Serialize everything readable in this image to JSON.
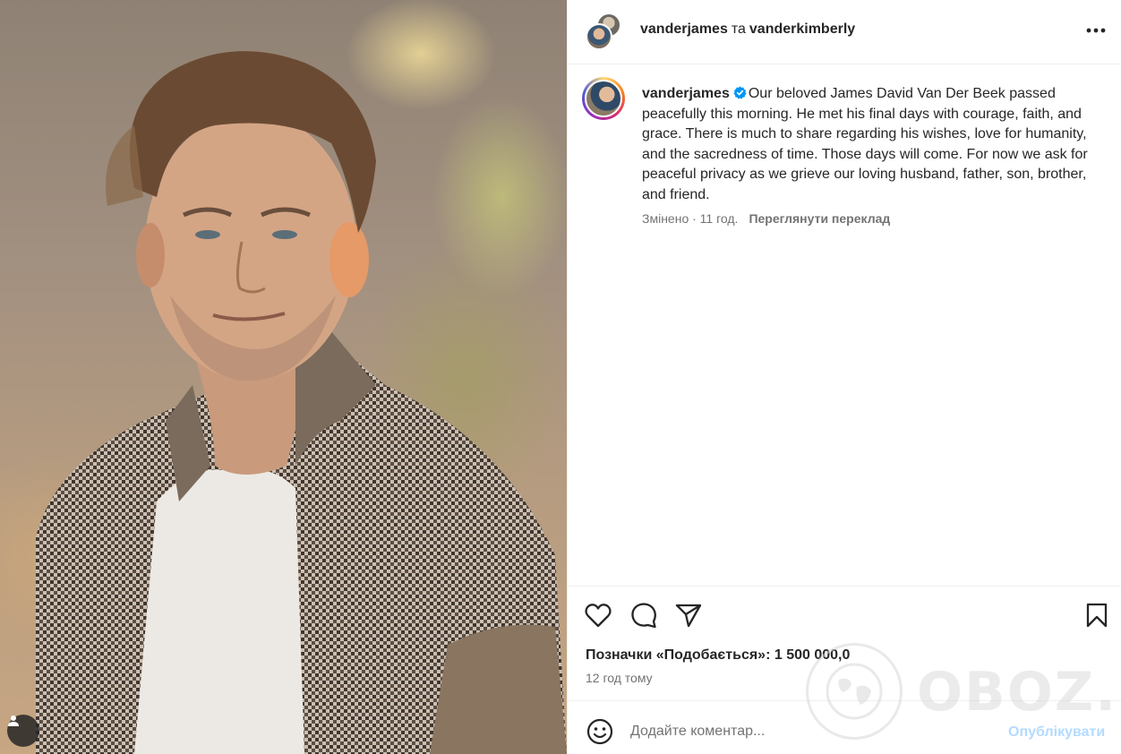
{
  "post": {
    "header": {
      "user1": "vanderjames",
      "conjunction": "та",
      "user2": "vanderkimberly"
    },
    "caption": {
      "username": "vanderjames",
      "text": "Our beloved James David Van Der Beek passed peacefully this morning. He met his final days with courage, faith, and grace. There is much to share regarding his wishes, love for humanity, and the sacredness of time. Those days will come. For now we ask for peaceful privacy as we grieve our loving husband, father, son, brother, and friend.",
      "meta": "Змінено · 11 год.",
      "translate_link": "Переглянути переклад"
    },
    "likes": "Позначки «Подобається»: 1 500 000,0",
    "time_ago": "12 год тому",
    "comment": {
      "placeholder": "Додайте коментар...",
      "publish_label": "Опублікувати"
    }
  },
  "icons": {
    "like": "heart-icon",
    "comment": "comment-bubble-icon",
    "share": "paper-plane-icon",
    "save": "bookmark-icon",
    "more": "more-dots-icon",
    "emoji": "emoji-smile-icon",
    "verified": "verified-badge-icon",
    "tagged_user": "user-silhouette-icon"
  },
  "colors": {
    "verified": "#0095f6",
    "publish_disabled": "#b3dbff",
    "muted_text": "#737373",
    "primary_text": "#262626"
  },
  "watermark": {
    "text": "OBOZ.UA"
  }
}
